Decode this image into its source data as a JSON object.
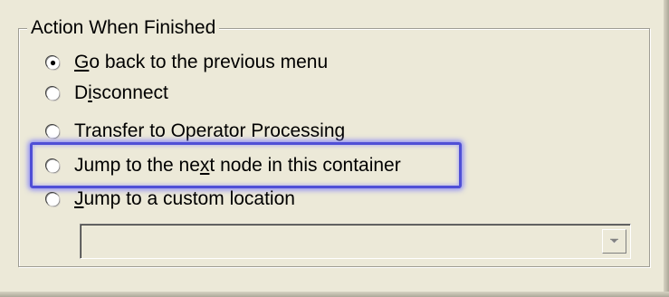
{
  "group": {
    "title": "Action When Finished"
  },
  "options": [
    {
      "before": "",
      "access_key": "G",
      "after": "o back to the previous menu",
      "checked": true
    },
    {
      "before": "D",
      "access_key": "i",
      "after": "sconnect",
      "checked": false
    },
    {
      "before": "",
      "access_key": "",
      "after": "Transfer to Operator Processing",
      "checked": false
    },
    {
      "before": "Jump to the ne",
      "access_key": "x",
      "after": "t node in this container",
      "checked": false
    },
    {
      "before": "",
      "access_key": "J",
      "after": "ump to a custom location",
      "checked": false
    }
  ],
  "location_select": {
    "value": ""
  },
  "icons": {
    "radio_checked": "radio-checked-icon",
    "radio_unchecked": "radio-unchecked-icon",
    "dropdown_arrow": "chevron-down-icon"
  },
  "colors": {
    "dialog_background": "#ece9d8",
    "highlight_border": "#4f4fd6"
  }
}
